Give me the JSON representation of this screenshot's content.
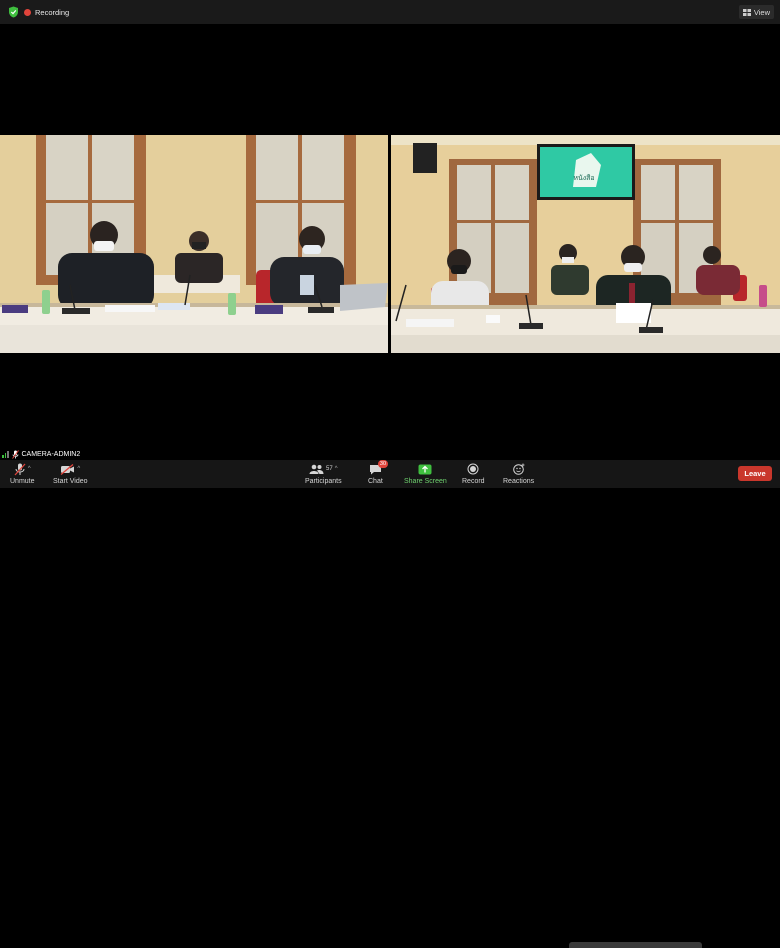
{
  "status": {
    "recording_label": "Recording",
    "view_label": "View"
  },
  "videos": {
    "left": {
      "description_colors": {
        "wall": "#e2cc98",
        "table": "#efeae0"
      }
    },
    "right": {
      "screen_text": "หนังสือ"
    }
  },
  "active_speaker": {
    "name": "CAMERA-ADMIN2"
  },
  "toolbar": {
    "unmute_label": "Unmute",
    "start_video_label": "Start Video",
    "participants_label": "Participants",
    "participants_count": "57",
    "chat_label": "Chat",
    "chat_badge": "30",
    "share_screen_label": "Share Screen",
    "record_label": "Record",
    "reactions_label": "Reactions",
    "leave_label": "Leave"
  },
  "colors": {
    "leave": "#c9372c",
    "share": "#3fbf3f",
    "recording": "#e0443b"
  }
}
